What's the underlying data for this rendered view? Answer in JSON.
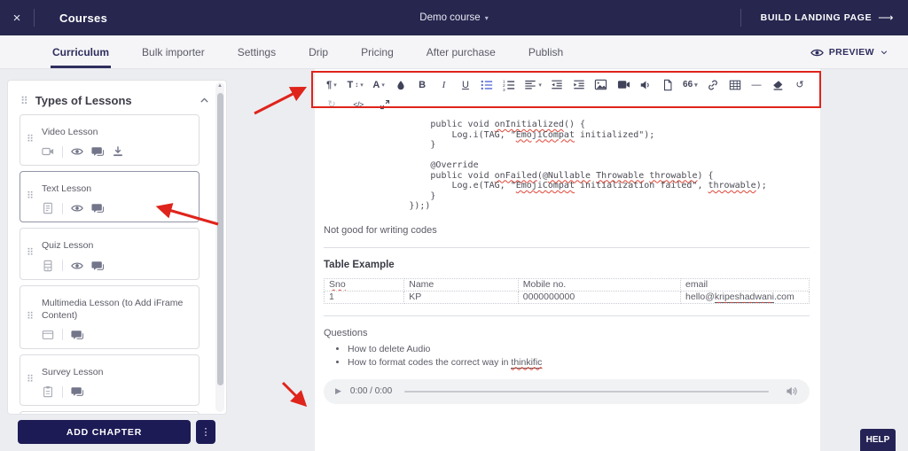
{
  "colors": {
    "nav_bg": "#26264f",
    "accent_navy": "#2f2e5e",
    "annotation_red": "#df241b",
    "panel_bg": "#ffffff",
    "page_bg": "#ecedf1",
    "button_bg": "#1d1b56"
  },
  "top_nav": {
    "close_glyph": "×",
    "title": "Courses",
    "course_selector": "Demo course",
    "caret": "▾",
    "build_landing_page": "BUILD LANDING PAGE",
    "arrow": "⟶"
  },
  "tab_bar": {
    "tabs": [
      {
        "label": "Curriculum",
        "active": true
      },
      {
        "label": "Bulk importer",
        "active": false
      },
      {
        "label": "Settings",
        "active": false
      },
      {
        "label": "Drip",
        "active": false
      },
      {
        "label": "Pricing",
        "active": false
      },
      {
        "label": "After purchase",
        "active": false
      },
      {
        "label": "Publish",
        "active": false
      }
    ],
    "preview_label": "PREVIEW"
  },
  "sidebar": {
    "grip_glyph": "⠿",
    "header": "Types of Lessons",
    "cards": [
      {
        "title": "Video Lesson"
      },
      {
        "title": "Text Lesson"
      },
      {
        "title": "Quiz Lesson"
      },
      {
        "title": "Multimedia Lesson (to Add iFrame Content)"
      },
      {
        "title": "Survey Lesson"
      }
    ],
    "add_chapter": "ADD CHAPTER",
    "kebab_glyph": "⋮"
  },
  "editor": {
    "toolbar": {
      "paragraph": "¶",
      "font_size": "T",
      "size_arrows": "↕",
      "text_color": "A",
      "bold": "B",
      "italic": "I",
      "underline": "U",
      "quote": "66",
      "hr": "—",
      "undo": "↺",
      "redo": "↻",
      "code": "</>",
      "caret": "▾"
    },
    "code": "                    public void onInitialized() {\n                        Log.i(TAG, \"EmojiCompat initialized\");\n                    }\n\n                    @Override\n                    public void onFailed(@Nullable Throwable throwable) {\n                        Log.e(TAG, \"EmojiCompat initialization failed\", throwable);\n                    }\n                });)",
    "paragraph": "Not good for writing codes",
    "table_heading": "Table Example",
    "table": {
      "headers": [
        "Sno",
        "Name",
        "Mobile no.",
        "email"
      ],
      "rows": [
        [
          "1",
          "KP",
          "0000000000",
          "hello@kripeshadwani.com"
        ]
      ]
    },
    "questions_heading": "Questions",
    "questions": [
      "How to delete Audio",
      "How to format codes the correct way in thinkific"
    ],
    "audio": {
      "time": "0:00 / 0:00",
      "play_glyph": "▶"
    }
  },
  "spellcheck_words": [
    "onInitialized",
    "EmojiCompat",
    "onFailed",
    "Nullable",
    "Throwable",
    "throwable",
    "kripeshadwani",
    "thinkific",
    "Sno"
  ],
  "help_label": "HELP"
}
